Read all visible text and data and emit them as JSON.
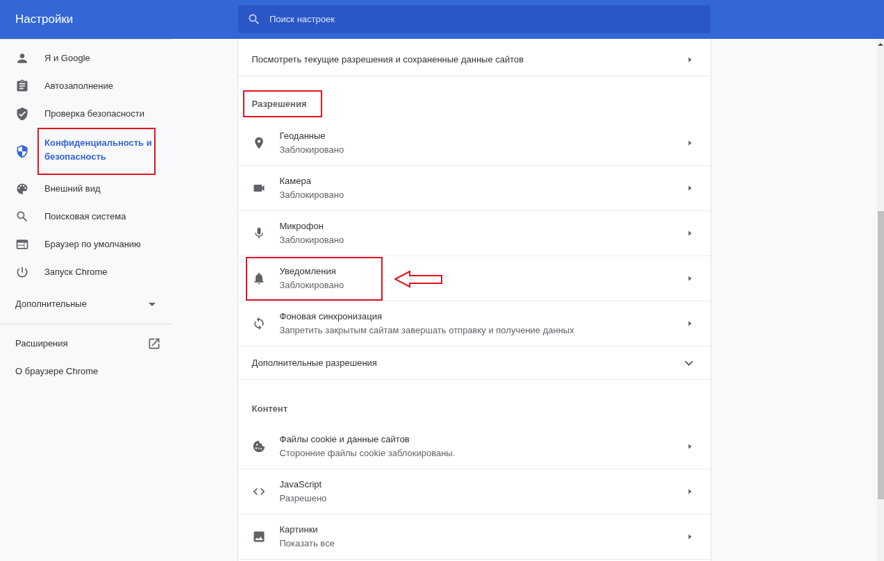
{
  "header": {
    "title": "Настройки",
    "search": {
      "placeholder": "Поиск настроек"
    }
  },
  "sidebar": {
    "items": [
      {
        "kind": "person",
        "label": "Я и Google",
        "selected": false,
        "highlighted": false
      },
      {
        "kind": "clipboard",
        "label": "Автозаполнение",
        "selected": false,
        "highlighted": false
      },
      {
        "kind": "shield-check",
        "label": "Проверка безопасности",
        "selected": false,
        "highlighted": false
      },
      {
        "kind": "shield",
        "label": "Конфиденциальность и безопасность",
        "selected": true,
        "highlighted": true
      },
      {
        "kind": "palette",
        "label": "Внешний вид",
        "selected": false,
        "highlighted": false
      },
      {
        "kind": "search",
        "label": "Поисковая система",
        "selected": false,
        "highlighted": false
      },
      {
        "kind": "browser",
        "label": "Браузер по умолчанию",
        "selected": false,
        "highlighted": false
      },
      {
        "kind": "power",
        "label": "Запуск Chrome",
        "selected": false,
        "highlighted": false
      }
    ],
    "advanced": {
      "label": "Дополнительные",
      "expanded": false
    },
    "links": [
      {
        "label": "Расширения",
        "external": true
      },
      {
        "label": "О браузере Chrome",
        "external": false
      }
    ]
  },
  "content": [
    {
      "kind": "link",
      "title": "Посмотреть текущие разрешения и сохраненные данные сайтов"
    },
    {
      "kind": "heading",
      "title": "Разрешения",
      "highlighted": true
    },
    {
      "kind": "location",
      "title": "Геоданные",
      "subtitle": "Заблокировано",
      "highlighted": false,
      "arrow": false
    },
    {
      "kind": "camera",
      "title": "Камера",
      "subtitle": "Заблокировано",
      "highlighted": false,
      "arrow": false
    },
    {
      "kind": "microphone",
      "title": "Микрофон",
      "subtitle": "Заблокировано",
      "highlighted": false,
      "arrow": false
    },
    {
      "kind": "bell",
      "title": "Уведомления",
      "subtitle": "Заблокировано",
      "highlighted": true,
      "arrow": true
    },
    {
      "kind": "sync",
      "title": "Фоновая синхронизация",
      "subtitle": "Запретить закрытым сайтам завершать отправку и получение данных",
      "highlighted": false,
      "arrow": false
    },
    {
      "kind": "expander",
      "title": "Дополнительные разрешения",
      "expanded": false
    },
    {
      "kind": "heading",
      "title": "Контент",
      "highlighted": false
    },
    {
      "kind": "cookie",
      "title": "Файлы cookie и данные сайтов",
      "subtitle": "Сторонние файлы cookie заблокированы.",
      "highlighted": false,
      "arrow": false
    },
    {
      "kind": "code",
      "title": "JavaScript",
      "subtitle": "Разрешено",
      "highlighted": false,
      "arrow": false
    },
    {
      "kind": "image",
      "title": "Картинки",
      "subtitle": "Показать все",
      "highlighted": false,
      "arrow": false
    }
  ]
}
